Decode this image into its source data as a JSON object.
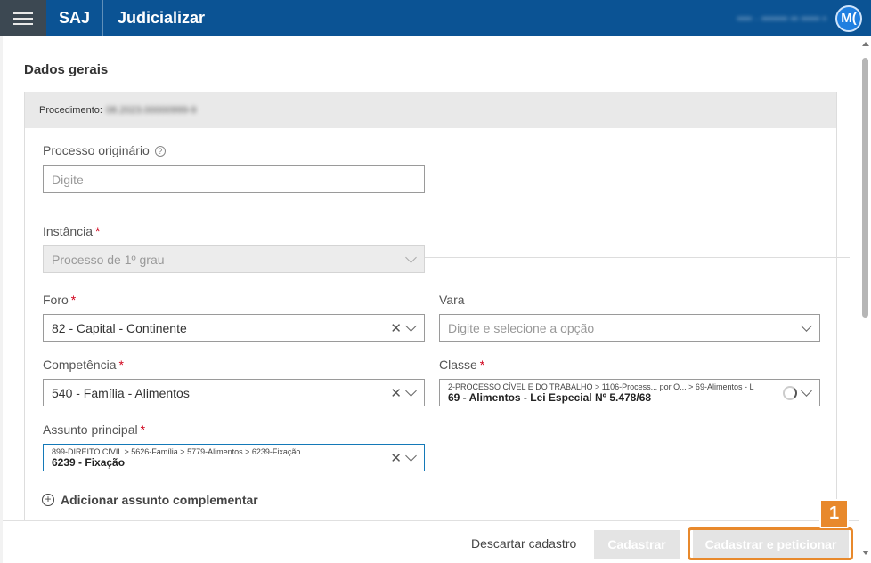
{
  "header": {
    "brand": "SAJ",
    "app_title": "Judicializar",
    "user_info_blurred": "•••• · ••••••• •• ••••• •",
    "avatar_initials": "M("
  },
  "form": {
    "section_title": "Dados gerais",
    "procedimento_label": "Procedimento:",
    "procedimento_value": "08.2023.00000999-9",
    "processo_originario": {
      "label": "Processo originário",
      "placeholder": "Digite"
    },
    "instancia": {
      "label": "Instância",
      "required_mark": "*",
      "value": "Processo de 1º grau"
    },
    "foro": {
      "label": "Foro",
      "required_mark": "*",
      "value": "82 - Capital - Continente"
    },
    "vara": {
      "label": "Vara",
      "placeholder": "Digite e selecione a opção"
    },
    "competencia": {
      "label": "Competência",
      "required_mark": "*",
      "value": "540 - Família - Alimentos"
    },
    "classe": {
      "label": "Classe",
      "required_mark": "*",
      "path": "2-PROCESSO CÍVEL E DO TRABALHO > 1106-Process... por O... > 69-Alimentos - L",
      "value": "69 - Alimentos - Lei Especial Nº 5.478/68"
    },
    "assunto_principal": {
      "label": "Assunto principal",
      "required_mark": "*",
      "path": "899-DIREITO CIVIL > 5626-Família > 5779-Alimentos > 6239-Fixação",
      "value": "6239 - Fixação"
    },
    "add_assunto_label": "Adicionar assunto complementar"
  },
  "footer": {
    "discard_label": "Descartar cadastro",
    "cadastrar_label": "Cadastrar",
    "cadastrar_peticionar_label": "Cadastrar e peticionar"
  },
  "annotation": {
    "step_number": "1",
    "color": "#e8892c"
  },
  "colors": {
    "topbar": "#0b5394",
    "required": "#d0021b"
  }
}
